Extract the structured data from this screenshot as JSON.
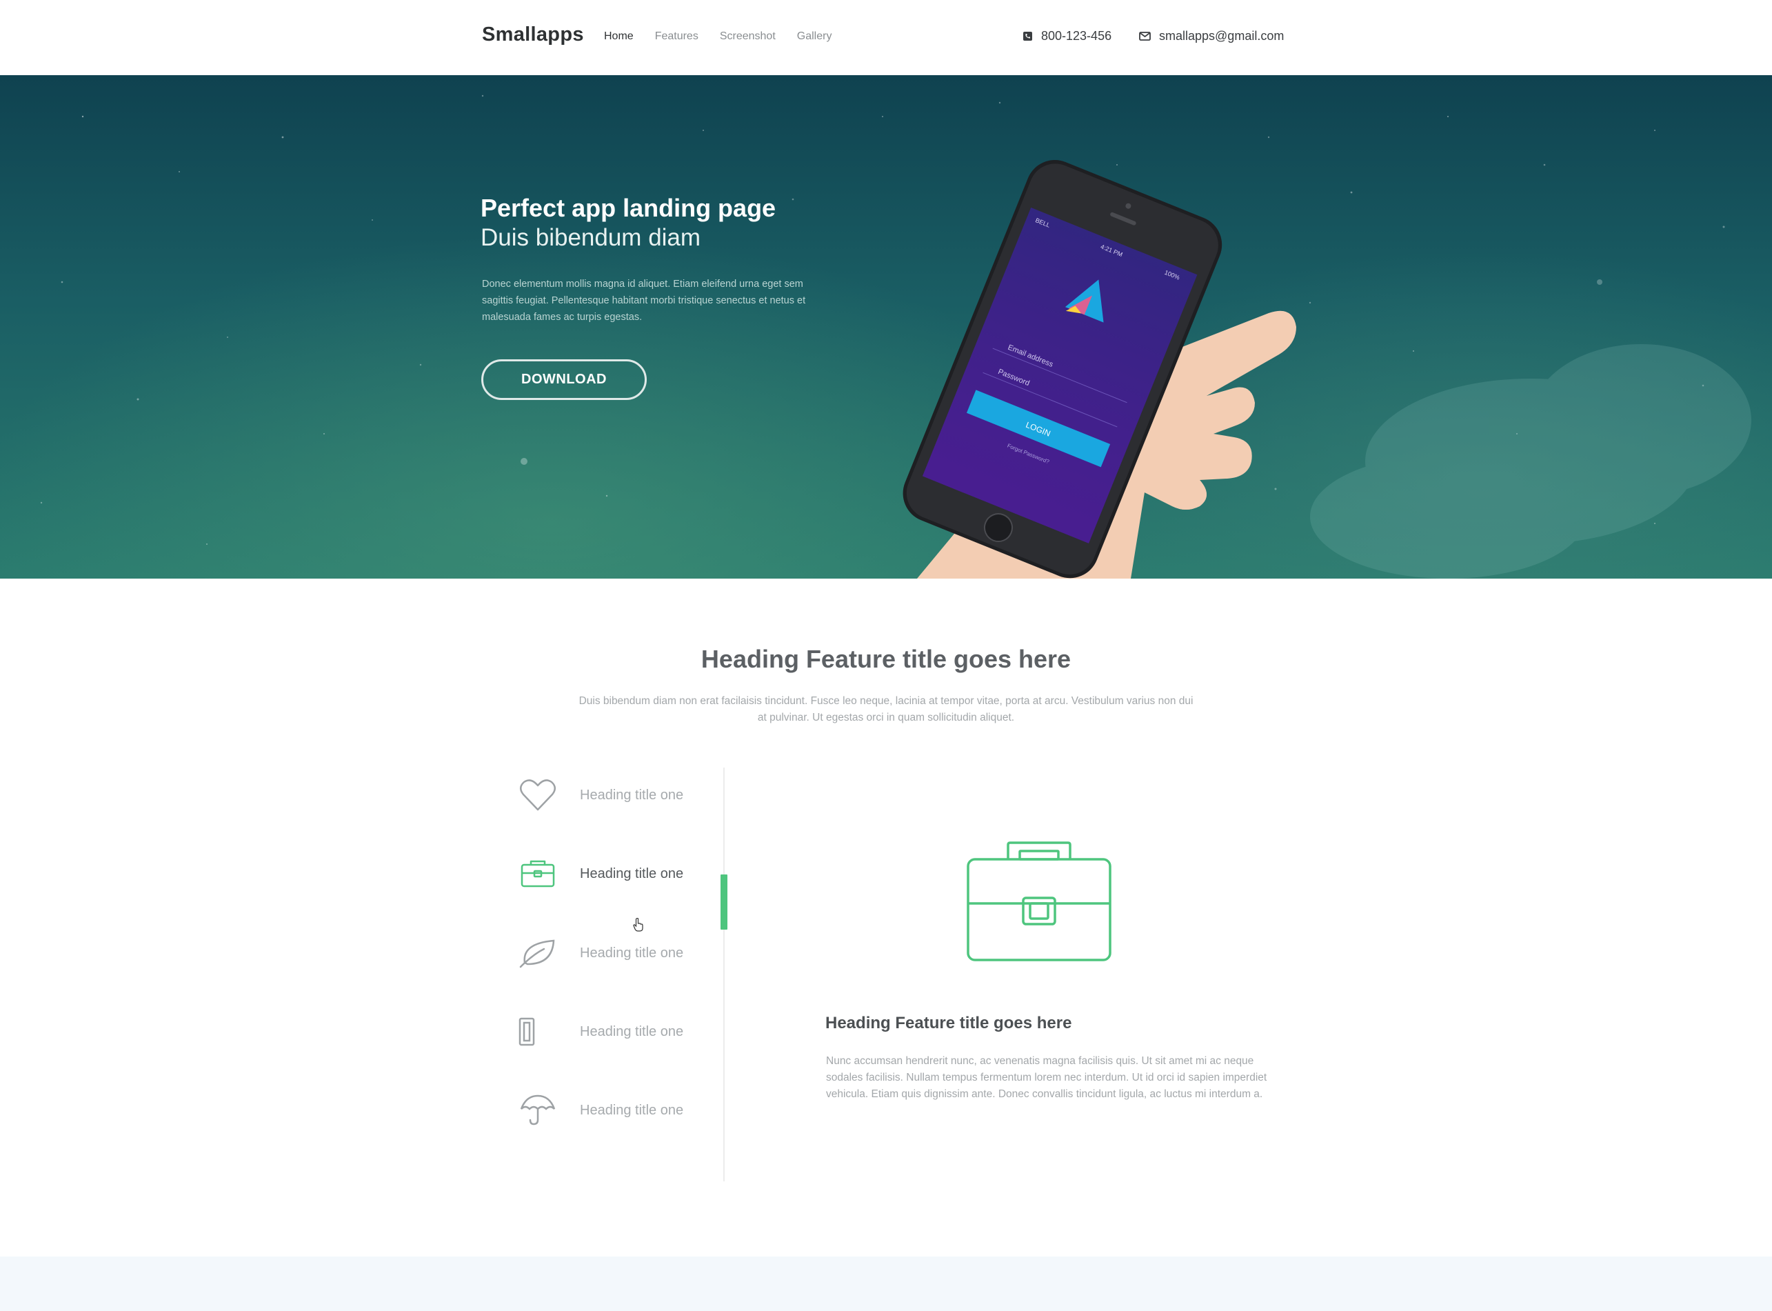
{
  "header": {
    "brand": "Smallapps",
    "nav": [
      "Home",
      "Features",
      "Screenshot",
      "Gallery"
    ],
    "phone": "800-123-456",
    "email": "smallapps@gmail.com"
  },
  "hero": {
    "title": "Perfect app landing page",
    "subtitle": "Duis bibendum diam",
    "text": "Donec elementum mollis magna id aliquet. Etiam eleifend urna eget sem sagittis feugiat. Pellentesque habitant morbi tristique senectus et netus et malesuada fames ac turpis egestas.",
    "download_label": "DOWNLOAD",
    "phone_screen": {
      "carrier": "BELL",
      "time": "4:21 PM",
      "battery": "100%",
      "email_placeholder": "Email address",
      "password_placeholder": "Password",
      "login_label": "LOGIN",
      "forgot_label": "Forgot Password?"
    }
  },
  "features": {
    "heading": "Heading Feature title goes here",
    "description": "Duis bibendum diam non erat facilaisis tincidunt. Fusce leo neque, lacinia at tempor vitae, porta at arcu. Vestibulum varius non dui at pulvinar. Ut egestas orci in quam sollicitudin aliquet.",
    "tabs": [
      {
        "label": "Heading title one",
        "icon": "heart-icon"
      },
      {
        "label": "Heading title one",
        "icon": "toolbox-icon"
      },
      {
        "label": "Heading title one",
        "icon": "leaf-icon"
      },
      {
        "label": "Heading title one",
        "icon": "phone-icon"
      },
      {
        "label": "Heading title one",
        "icon": "umbrella-icon"
      }
    ],
    "active_tab": 1,
    "detail_title": "Heading Feature title goes here",
    "detail_text": "Nunc accumsan hendrerit nunc, ac venenatis magna facilisis quis. Ut sit amet mi ac neque sodales facilisis. Nullam tempus fermentum lorem nec interdum. Ut id orci id sapien imperdiet vehicula. Etiam quis dignissim ante. Donec convallis tincidunt ligula, ac luctus mi interdum a."
  },
  "colors": {
    "accent": "#4ec57e",
    "hero_top": "#0f4250",
    "hero_bottom": "#2b7c6f",
    "phone_screen": "#3d1f8a",
    "login_button": "#1aa7e0"
  }
}
